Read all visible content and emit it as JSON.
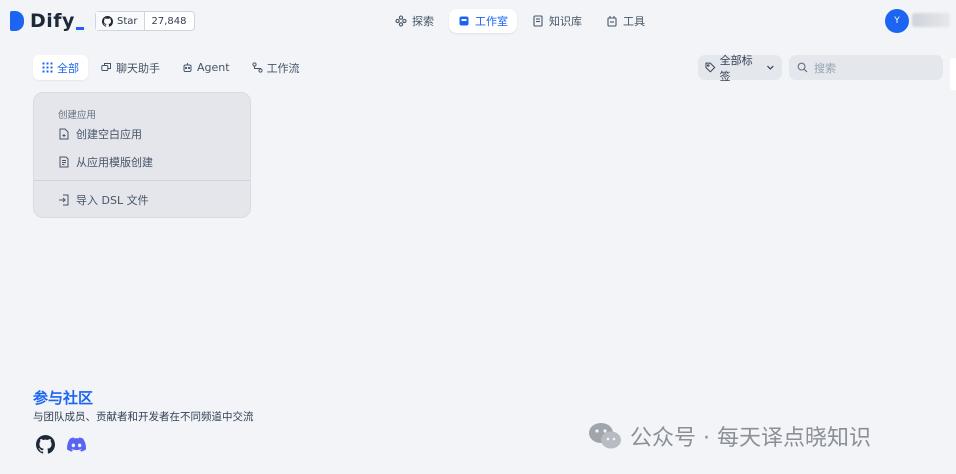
{
  "header": {
    "brand": "Dify",
    "github": {
      "star_label": "Star",
      "star_count": "27,848"
    },
    "nav": [
      {
        "label": "探索",
        "icon": "explore-icon",
        "active": false
      },
      {
        "label": "工作室",
        "icon": "studio-icon",
        "active": true
      },
      {
        "label": "知识库",
        "icon": "knowledge-icon",
        "active": false
      },
      {
        "label": "工具",
        "icon": "tools-icon",
        "active": false
      }
    ],
    "user": {
      "avatar_initial": "Y"
    }
  },
  "toolbar": {
    "tabs": [
      {
        "label": "全部",
        "icon": "grid-icon",
        "active": true
      },
      {
        "label": "聊天助手",
        "icon": "chat-assistant-icon",
        "active": false
      },
      {
        "label": "Agent",
        "icon": "agent-icon",
        "active": false
      },
      {
        "label": "工作流",
        "icon": "workflow-icon",
        "active": false
      }
    ],
    "tag_filter": {
      "label": "全部标签",
      "icon": "tag-icon"
    },
    "search": {
      "placeholder": "搜索",
      "icon": "search-icon"
    }
  },
  "create_card": {
    "title": "创建应用",
    "items": [
      {
        "label": "创建空白应用",
        "icon": "blank-file-icon"
      },
      {
        "label": "从应用模版创建",
        "icon": "template-icon"
      },
      {
        "label": "导入 DSL 文件",
        "icon": "import-icon"
      }
    ]
  },
  "community": {
    "title": "参与社区",
    "description": "与团队成员、贡献者和开发者在不同频道中交流",
    "links": [
      {
        "icon": "github-icon"
      },
      {
        "icon": "discord-icon"
      }
    ]
  },
  "watermark": {
    "text": "公众号 · 每天译点晓知识",
    "icon": "wechat-icon"
  },
  "colors": {
    "accent": "#1c64f2",
    "background": "#f2f4f7"
  }
}
